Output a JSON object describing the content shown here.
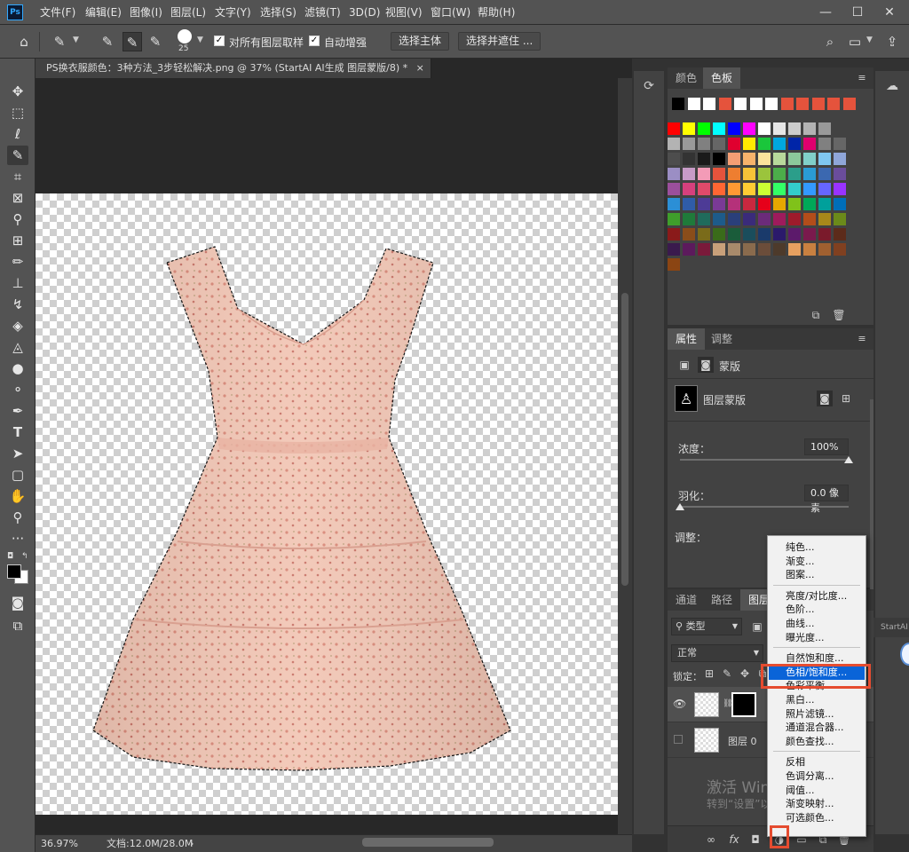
{
  "app": {
    "logo": "Ps"
  },
  "menubar": {
    "items": [
      "文件(F)",
      "编辑(E)",
      "图像(I)",
      "图层(L)",
      "文字(Y)",
      "选择(S)",
      "滤镜(T)",
      "3D(D)",
      "视图(V)",
      "窗口(W)",
      "帮助(H)"
    ],
    "minimize": "—",
    "maximize": "☐",
    "close": "✕"
  },
  "options": {
    "brush_size": "25",
    "sample_all_layers": "对所有图层取样",
    "auto_enhance": "自动增强",
    "select_subject": "选择主体",
    "select_and_mask": "选择并遮住 ..."
  },
  "document": {
    "tab_title": "PS换衣服颜色：3种方法_3步轻松解决.png @ 37% (StartAI AI生成 图层蒙版/8) *",
    "tab_close": "×"
  },
  "status": {
    "zoom": "36.97%",
    "doc_size": "文档:12.0M/28.0M",
    "arrow": "›"
  },
  "color_panel": {
    "tabs": [
      "颜色",
      "色板"
    ],
    "recent_colors": [
      "#000000",
      "#ffffff",
      "#ffffff",
      "#e5533c",
      "#ffffff",
      "#ffffff",
      "#ffffff",
      "#e5533c",
      "#e5533c",
      "#e5533c",
      "#e5533c",
      "#e5533c",
      "#e5533c",
      "#e5533c",
      "#e5533c",
      "#e5533c",
      "#e5533c",
      "#e5533c",
      "#e5533c",
      "#e5533c",
      "#e5533c"
    ],
    "swatch_rows": [
      [
        "#ff0000",
        "#ffff00",
        "#00ff00",
        "#00ffff",
        "#0000ff",
        "#ff00ff",
        "#ffffff",
        "#e6e6e6",
        "#cccccc",
        "#b3b3b3",
        "#999999"
      ],
      [
        "#b3b3b3",
        "#999999",
        "#808080",
        "#666666",
        "#e0002f",
        "#ffea00",
        "#1ac63b",
        "#00a7e0",
        "#0025a8",
        "#e0006e",
        "#808080",
        "#666666"
      ],
      [
        "#4d4d4d",
        "#333333",
        "#1a1a1a",
        "#000000",
        "#f59e74",
        "#f7b36b",
        "#fbe39b",
        "#b8d99b",
        "#8cc99b",
        "#80cfc9",
        "#7fc7f0",
        "#8fa6d9"
      ],
      [
        "#9b8ec4",
        "#c79bc7",
        "#f39bb7",
        "#e5533c",
        "#ee7e30",
        "#f6c338",
        "#9bc43c",
        "#4cad4a",
        "#2b9e8a",
        "#2a9bd4",
        "#3b68b0",
        "#6a4d9c"
      ],
      [
        "#9b4f9c",
        "#d6407d",
        "#e04a6a",
        "#ff6633",
        "#ff9933",
        "#ffcc33",
        "#ccff33",
        "#33ff66",
        "#33cccc",
        "#3399ff",
        "#6666ff",
        "#9933ff"
      ],
      [
        "#2b8fd6",
        "#2f5ca8",
        "#4d3b96",
        "#7a3a96",
        "#b5317a",
        "#c9283f",
        "#e6001a",
        "#e6a800",
        "#80c21a",
        "#00a858",
        "#00a09b",
        "#006eb8"
      ],
      [
        "#3f9e2b",
        "#1f7a3a",
        "#1f6b5c",
        "#1d5b8a",
        "#2a3f7a",
        "#3a2b7a",
        "#6b2b7a",
        "#9e1b5c",
        "#9e1b2b",
        "#b34d1a",
        "#a8881a",
        "#6b8a1a"
      ],
      [
        "#8a1a1a",
        "#8a4d1a",
        "#7a6b1a",
        "#3a6b1a",
        "#1a5c3a",
        "#1a4d5c",
        "#1a3a6b",
        "#2b1a6b",
        "#5c1a6b",
        "#7a1a4d",
        "#7a1a2b",
        "#5c2b1a"
      ],
      [
        "#3a1a4d",
        "#5c1a5c",
        "#7a1a3a",
        "#c8a07a",
        "#a88a6b",
        "#8a6b4d",
        "#6b4d3a",
        "#4d3a2b",
        "#e6a060",
        "#c88040",
        "#a06030",
        "#804020"
      ],
      [
        "#8b4513"
      ]
    ]
  },
  "properties": {
    "tabs": [
      "属性",
      "调整"
    ],
    "kind": "蒙版",
    "layer_mask": "图层蒙版",
    "density_label": "浓度：",
    "density_value": "100%",
    "density_level": 100,
    "feather_label": "羽化：",
    "feather_value": "0.0 像素",
    "feather_level": 0,
    "refine_label": "调整："
  },
  "layers": {
    "tabs": [
      "通道",
      "路径",
      "图层"
    ],
    "filter_kind": "类型",
    "blend_mode": "正常",
    "lock_label": "锁定：",
    "layer0": "图层 0",
    "bottom_icons": [
      "∞",
      "fx",
      "◘",
      "◑",
      "▭",
      "⧉",
      "🗑"
    ]
  },
  "adjust_menu": {
    "groups": [
      [
        "纯色...",
        "渐变...",
        "图案..."
      ],
      [
        "亮度/对比度...",
        "色阶...",
        "曲线...",
        "曝光度..."
      ],
      [
        "自然饱和度...",
        "色相/饱和度...",
        "色彩平衡...",
        "黑白...",
        "照片滤镜...",
        "通道混合器...",
        "颜色查找..."
      ],
      [
        "反相",
        "色调分离...",
        "阈值...",
        "渐变映射...",
        "可选颜色..."
      ]
    ],
    "selected": "色相/饱和度..."
  },
  "watermark": {
    "line1": "激活 Windows",
    "line2": "转到“设置”以激活 Windows。"
  },
  "side_plugin": "StartAI"
}
